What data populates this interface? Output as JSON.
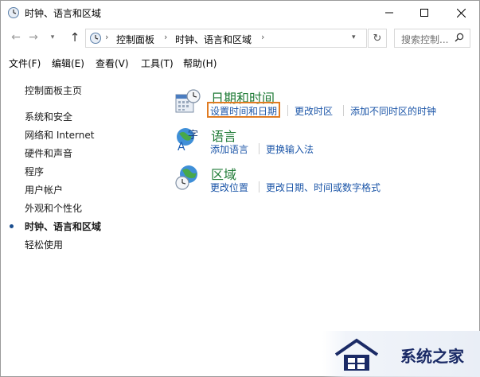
{
  "window": {
    "title": "时钟、语言和区域"
  },
  "address": {
    "crumbs": [
      "控制面板",
      "时钟、语言和区域"
    ],
    "search_placeholder": "搜索控制..."
  },
  "menu": [
    "文件(F)",
    "编辑(E)",
    "查看(V)",
    "工具(T)",
    "帮助(H)"
  ],
  "left_nav": {
    "home": "控制面板主页",
    "items": [
      "系统和安全",
      "网络和 Internet",
      "硬件和声音",
      "程序",
      "用户帐户",
      "外观和个性化",
      "时钟、语言和区域",
      "轻松使用"
    ],
    "current_index": 6
  },
  "categories": [
    {
      "title": "日期和时间",
      "links": [
        "设置时间和日期",
        "更改时区",
        "添加不同时区的时钟"
      ],
      "icon": "calendar-clock-icon"
    },
    {
      "title": "语言",
      "links": [
        "添加语言",
        "更换输入法"
      ],
      "icon": "language-icon"
    },
    {
      "title": "区域",
      "links": [
        "更改位置",
        "更改日期、时间或数字格式"
      ],
      "icon": "globe-clock-icon"
    }
  ],
  "highlight_color": "#e07b22",
  "link_color": "#1c56a8",
  "category_color": "#1e7a35",
  "watermark": {
    "text": "系统之家"
  }
}
